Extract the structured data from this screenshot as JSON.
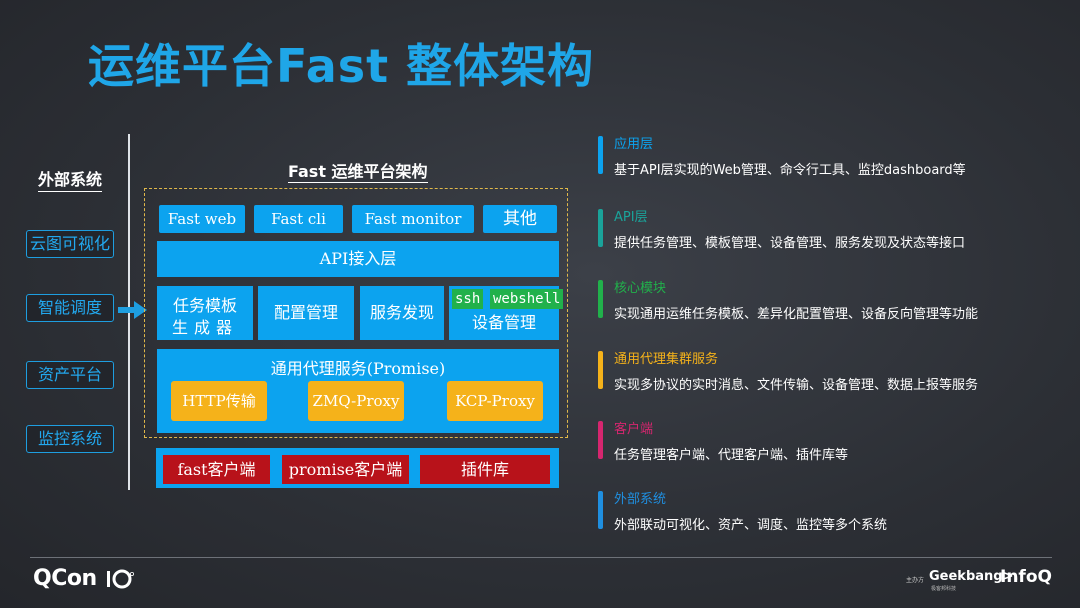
{
  "title": "运维平台Fast 整体架构",
  "external": {
    "title": "外部系统",
    "items": [
      "云图可视化",
      "智能调度",
      "资产平台",
      "监控系统"
    ]
  },
  "architecture": {
    "title": "Fast 运维平台架构",
    "app_layer": [
      "Fast web",
      "Fast cli",
      "Fast monitor",
      "其他"
    ],
    "api_layer": "API接入层",
    "core": {
      "template_line1": "任务模板",
      "template_line2": "生成器",
      "config": "配置管理",
      "discovery": "服务发现",
      "device": "设备管理",
      "chip_ssh": "ssh",
      "chip_webshell": "webshell"
    },
    "proxy": {
      "label": "通用代理服务(Promise)",
      "items": [
        "HTTP传输",
        "ZMQ-Proxy",
        "KCP-Proxy"
      ]
    },
    "clients": [
      "fast客户端",
      "promise客户端",
      "插件库"
    ]
  },
  "legend": [
    {
      "head": "应用层",
      "desc": "基于API层实现的Web管理、命令行工具、监控dashboard等",
      "color": "#0ca3ef"
    },
    {
      "head": "API层",
      "desc": "提供任务管理、模板管理、设备管理、服务发现及状态等接口",
      "color": "#1aa39a"
    },
    {
      "head": "核心模块",
      "desc": "实现通用运维任务模板、差异化配置管理、设备反向管理等功能",
      "color": "#21b14b"
    },
    {
      "head": "通用代理集群服务",
      "desc": "实现多协议的实时消息、文件传输、设备管理、数据上报等服务",
      "color": "#f5b21a"
    },
    {
      "head": "客户端",
      "desc": "任务管理客户端、代理客户端、插件库等",
      "color": "#d6266f"
    },
    {
      "head": "外部系统",
      "desc": "外部联动可视化、资产、调度、监控等多个系统",
      "color": "#1f8fe0"
    }
  ],
  "footer": {
    "brand": "QCon",
    "host": "主办方",
    "geek": "Geekbang>.",
    "geek_sub": "极客邦科技",
    "infoq": "InfoQ"
  }
}
